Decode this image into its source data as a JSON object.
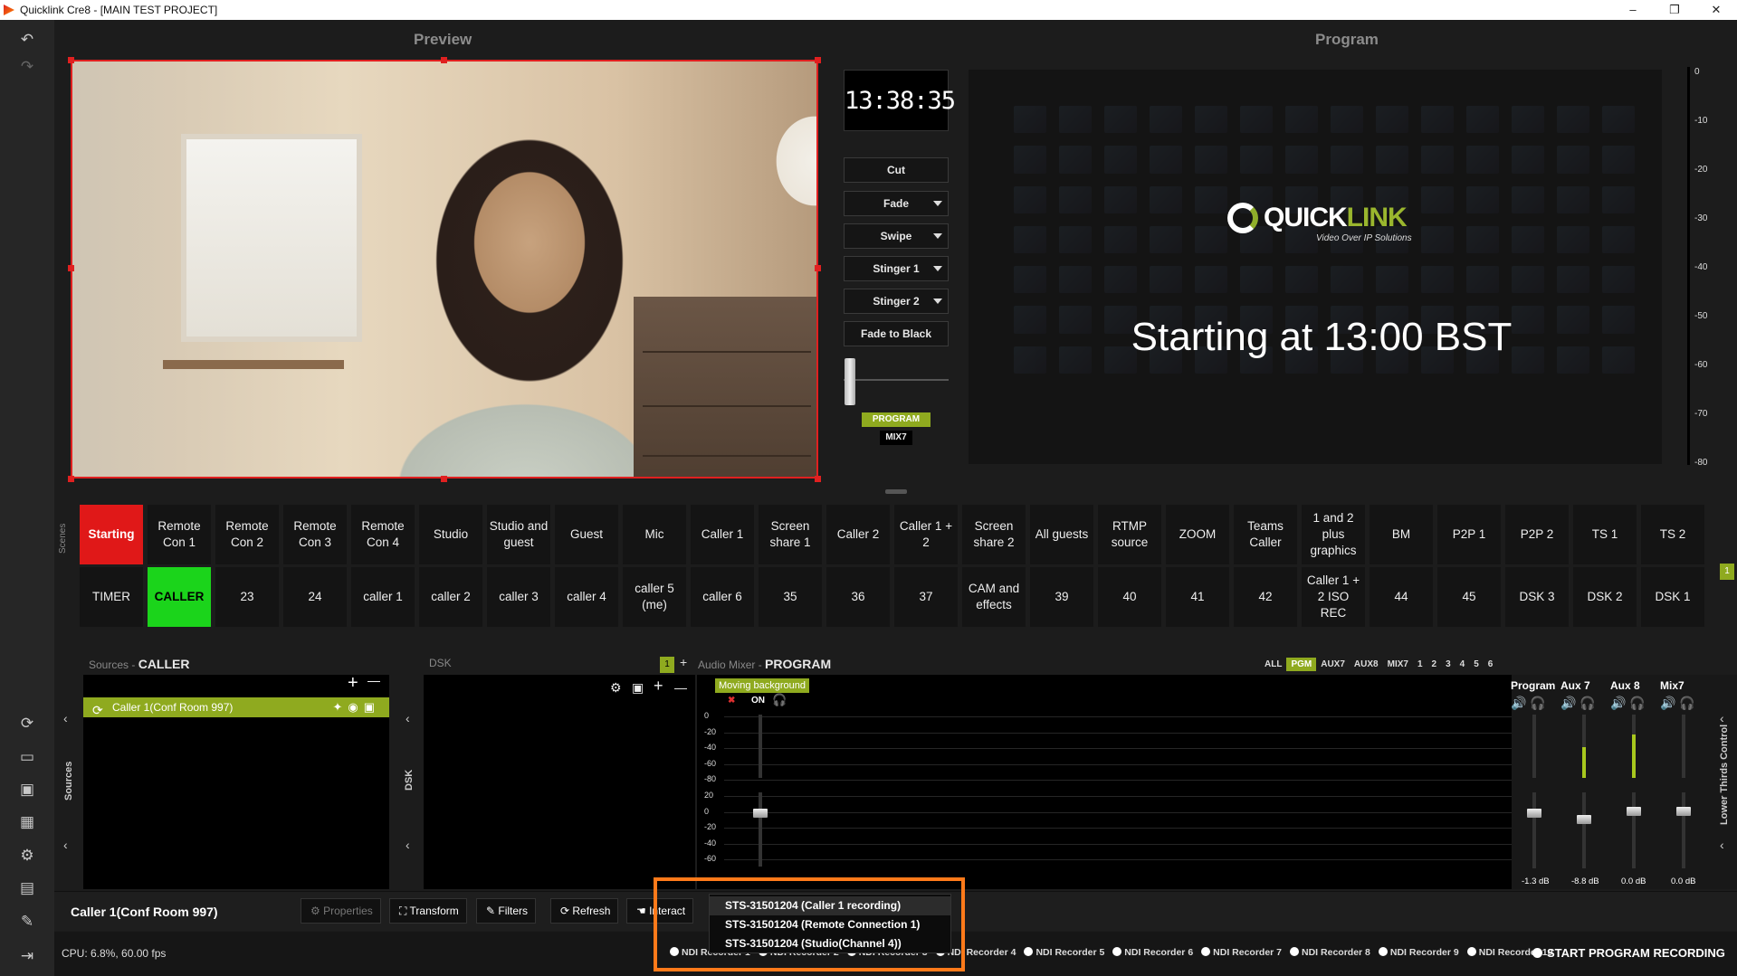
{
  "window": {
    "title": "Quicklink Cre8 - [MAIN TEST PROJECT]",
    "minimize": "–",
    "maximize": "❐",
    "close": "✕"
  },
  "toolbar_left": {
    "undo": "↶",
    "redo": "↷",
    "icons": [
      "link-icon",
      "monitor-icon",
      "display-icon",
      "grid-icon",
      "settings-icon",
      "folder-icon",
      "wrench-icon",
      "exit-icon"
    ]
  },
  "preview": {
    "title": "Preview"
  },
  "program": {
    "title": "Program",
    "logo_main": "QUICK",
    "logo_accent": "LINK",
    "logo_sub": "Video Over IP Solutions",
    "caption": "Starting at 13:00 BST"
  },
  "clock": "13:38:35",
  "transitions": [
    {
      "label": "Cut",
      "dropdown": false
    },
    {
      "label": "Fade",
      "dropdown": true
    },
    {
      "label": "Swipe",
      "dropdown": true
    },
    {
      "label": "Stinger 1",
      "dropdown": true
    },
    {
      "label": "Stinger 2",
      "dropdown": true
    },
    {
      "label": "Fade to Black",
      "dropdown": false
    }
  ],
  "program_badge": "PROGRAM",
  "mix_badge": "MIX7",
  "vu_ticks": [
    "0",
    "-10",
    "-20",
    "-30",
    "-40",
    "-50",
    "-60",
    "-70",
    "-80"
  ],
  "scenes_label": "Scenes",
  "scenes_row1": [
    "Starting",
    "Remote Con 1",
    "Remote Con 2",
    "Remote Con 3",
    "Remote Con 4",
    "Studio",
    "Studio and guest",
    "Guest",
    "Mic",
    "Caller 1",
    "Screen share 1",
    "Caller 2",
    "Caller 1 + 2",
    "Screen share 2",
    "All guests",
    "RTMP source",
    "ZOOM",
    "Teams Caller",
    "1 and 2 plus graphics",
    "BM",
    "P2P 1",
    "P2P 2",
    "TS 1",
    "TS 2"
  ],
  "scenes_row2": [
    "TIMER",
    "CALLER",
    "23",
    "24",
    "caller 1",
    "caller 2",
    "caller 3",
    "caller 4",
    "caller 5 (me)",
    "caller 6",
    "35",
    "36",
    "37",
    "CAM and effects",
    "39",
    "40",
    "41",
    "42",
    "Caller 1 + 2 ISO REC",
    "44",
    "45",
    "DSK 3",
    "DSK 2",
    "DSK 1"
  ],
  "scene_active_preview": "Starting",
  "scene_active_program": "CALLER",
  "scene_page": "1",
  "sources": {
    "header_prefix": "Sources",
    "header_scene": "CALLER",
    "side_label": "Sources",
    "item": "Caller 1(Conf Room 997)",
    "plus": "+",
    "minus": "—"
  },
  "dsk": {
    "header": "DSK",
    "side_label": "DSK",
    "page": "1",
    "plus": "+"
  },
  "audio_mixer": {
    "header_prefix": "Audio Mixer",
    "header_target": "PROGRAM",
    "tabs": [
      "ALL",
      "PGM",
      "AUX7",
      "AUX8",
      "MIX7",
      "1",
      "2",
      "3",
      "4",
      "5",
      "6"
    ],
    "active_tab": "PGM",
    "channel_name": "Moving background",
    "on_label": "ON",
    "meter_ticks": [
      "0",
      "-20",
      "-40",
      "-60",
      "-80"
    ],
    "fader_ticks": [
      "20",
      "0",
      "-20",
      "-40",
      "-60"
    ],
    "buses": [
      {
        "name": "Program",
        "db": "-1.3 dB",
        "level": 0.88
      },
      {
        "name": "Aux 7",
        "db": "-8.8 dB",
        "level": 0.8
      },
      {
        "name": "Aux 8",
        "db": "0.0 dB",
        "level": 0.9
      },
      {
        "name": "Mix7",
        "db": "0.0 dB",
        "level": 0.9
      }
    ],
    "lower_thirds": "Lower Thirds Control"
  },
  "bottom": {
    "selected": "Caller 1(Conf Room 997)",
    "buttons": [
      "Properties",
      "Transform",
      "Filters",
      "Refresh",
      "Interact"
    ]
  },
  "popup": {
    "items": [
      "STS-31501204 (Caller 1 recording)",
      "STS-31501204 (Remote Connection 1)",
      "STS-31501204 (Studio(Channel 4))"
    ]
  },
  "status": {
    "cpu": "CPU: 6.8%, 60.00 fps",
    "recorders": [
      "NDI Recorder 1",
      "NDI Recorder 2",
      "NDI Recorder 3",
      "NDI Recorder 4",
      "NDI Recorder 5",
      "NDI Recorder 6",
      "NDI Recorder 7",
      "NDI Recorder 8",
      "NDI Recorder 9",
      "NDI Recorder 10"
    ],
    "start_recording": "START PROGRAM RECORDING"
  },
  "colors": {
    "accent": "#8faa1f",
    "preview_border": "#e02020",
    "highlight": "#ff7a1a",
    "active_red": "#e01818",
    "active_green": "#1bd41b"
  }
}
